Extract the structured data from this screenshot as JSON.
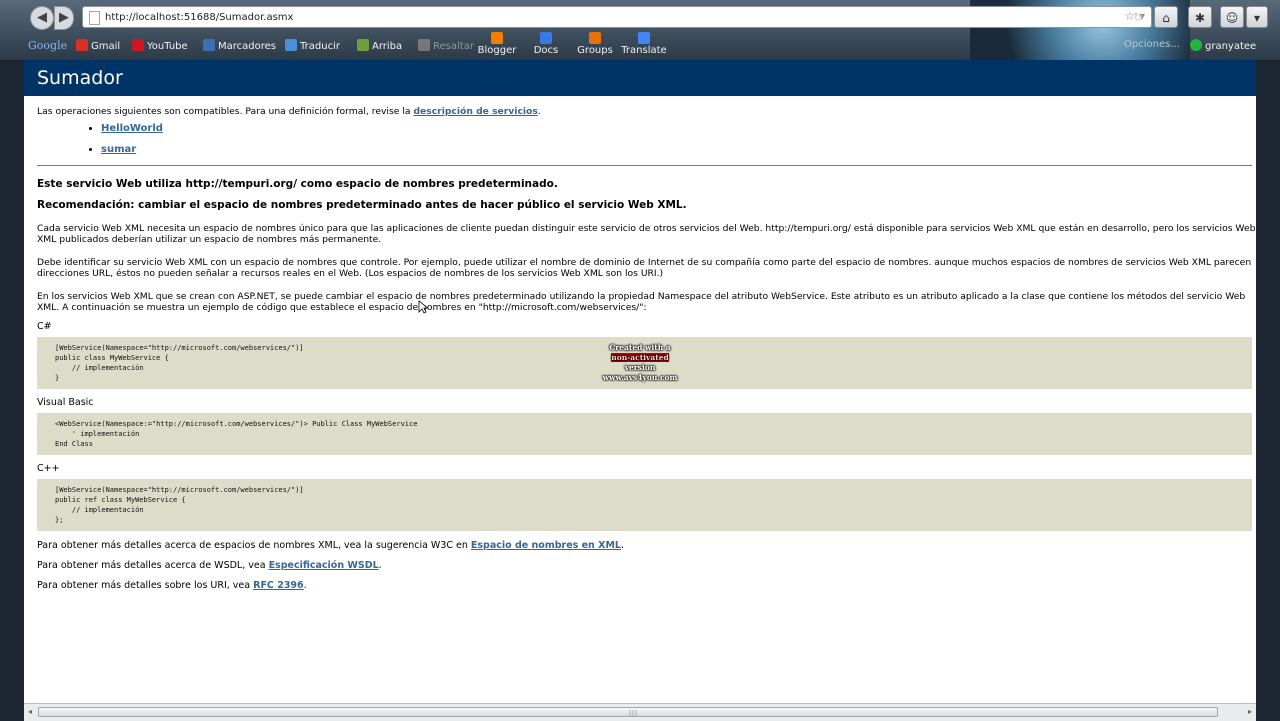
{
  "browser": {
    "url": "http://localhost:51688/Sumador.asmx",
    "user": "granyatee",
    "options_label": "Opciones..."
  },
  "bookmarks": {
    "search_brand": "Google",
    "items": [
      {
        "label": "Gmail",
        "color": "#d93025"
      },
      {
        "label": "YouTube",
        "color": "#cc181e"
      },
      {
        "label": "Marcadores",
        "color": "#3d6fb6"
      },
      {
        "label": "Traducir",
        "color": "#4a90d9"
      },
      {
        "label": "Arriba",
        "color": "#6fa13b"
      },
      {
        "label": "Resaltar",
        "color": "#999999"
      }
    ],
    "apps": [
      {
        "label": "Blogger",
        "color": "#f57d00"
      },
      {
        "label": "Docs",
        "color": "#3b78e7"
      },
      {
        "label": "Groups",
        "color": "#e8710a"
      },
      {
        "label": "Translate",
        "color": "#4285f4"
      }
    ]
  },
  "page": {
    "title": "Sumador",
    "intro_text": "Las operaciones siguientes son compatibles. Para una definición formal, revise la ",
    "intro_link": "descripción de servicios",
    "operations": [
      "HelloWorld",
      "sumar"
    ],
    "heading1": "Este servicio Web utiliza http://tempuri.org/ como espacio de nombres predeterminado.",
    "heading2": "Recomendación: cambiar el espacio de nombres predeterminado antes de hacer público el servicio Web XML.",
    "p1": "Cada servicio Web XML necesita un espacio de nombres único para que las aplicaciones de cliente puedan distinguir este servicio de otros servicios del Web. http://tempuri.org/ está disponible para servicios Web XML que están en desarrollo, pero los servicios Web XML publicados deberían utilizar un espacio de nombres más permanente.",
    "p2": "Debe identificar su servicio Web XML con un espacio de nombres que controle. Por ejemplo, puede utilizar el nombre de dominio de Internet de su compañía como parte del espacio de nombres. aunque muchos espacios de nombres de servicios Web XML parecen direcciones URL, éstos no pueden señalar a recursos reales en el Web. (Los espacios de nombres de los servicios Web XML son los URI.)",
    "p3": "En los servicios Web XML que se crean con ASP.NET, se puede cambiar el espacio de nombres predeterminado utilizando la propiedad Namespace del atributo WebService. Este atributo es un atributo aplicado a la clase que contiene los métodos del servicio Web XML. A continuación se muestra un ejemplo de código que establece el espacio de nombres en \"http://microsoft.com/webservices/\":",
    "code_samples": [
      {
        "lang": "C#",
        "code": "[WebService(Namespace=\"http://microsoft.com/webservices/\")]\npublic class MyWebService {\n    // implementación\n}"
      },
      {
        "lang": "Visual Basic",
        "code": "<WebService(Namespace:=\"http://microsoft.com/webservices/\")> Public Class MyWebService\n    ' implementación\nEnd Class"
      },
      {
        "lang": "C++",
        "code": "[WebService(Namespace=\"http://microsoft.com/webservices/\")]\npublic ref class MyWebService {\n    // implementación\n};"
      }
    ],
    "footer": [
      {
        "text": "Para obtener más detalles acerca de espacios de nombres XML, vea la sugerencia W3C en ",
        "link": "Espacio de nombres en XML"
      },
      {
        "text": "Para obtener más detalles acerca de WSDL, vea ",
        "link": "Especificación WSDL"
      },
      {
        "text": "Para obtener más detalles sobre los URI, vea ",
        "link": "RFC 2396"
      }
    ]
  },
  "watermark": {
    "line1": "Created with a",
    "line2a": "non-activated",
    "line2b": " version",
    "line3": "www.avs4you.com"
  }
}
